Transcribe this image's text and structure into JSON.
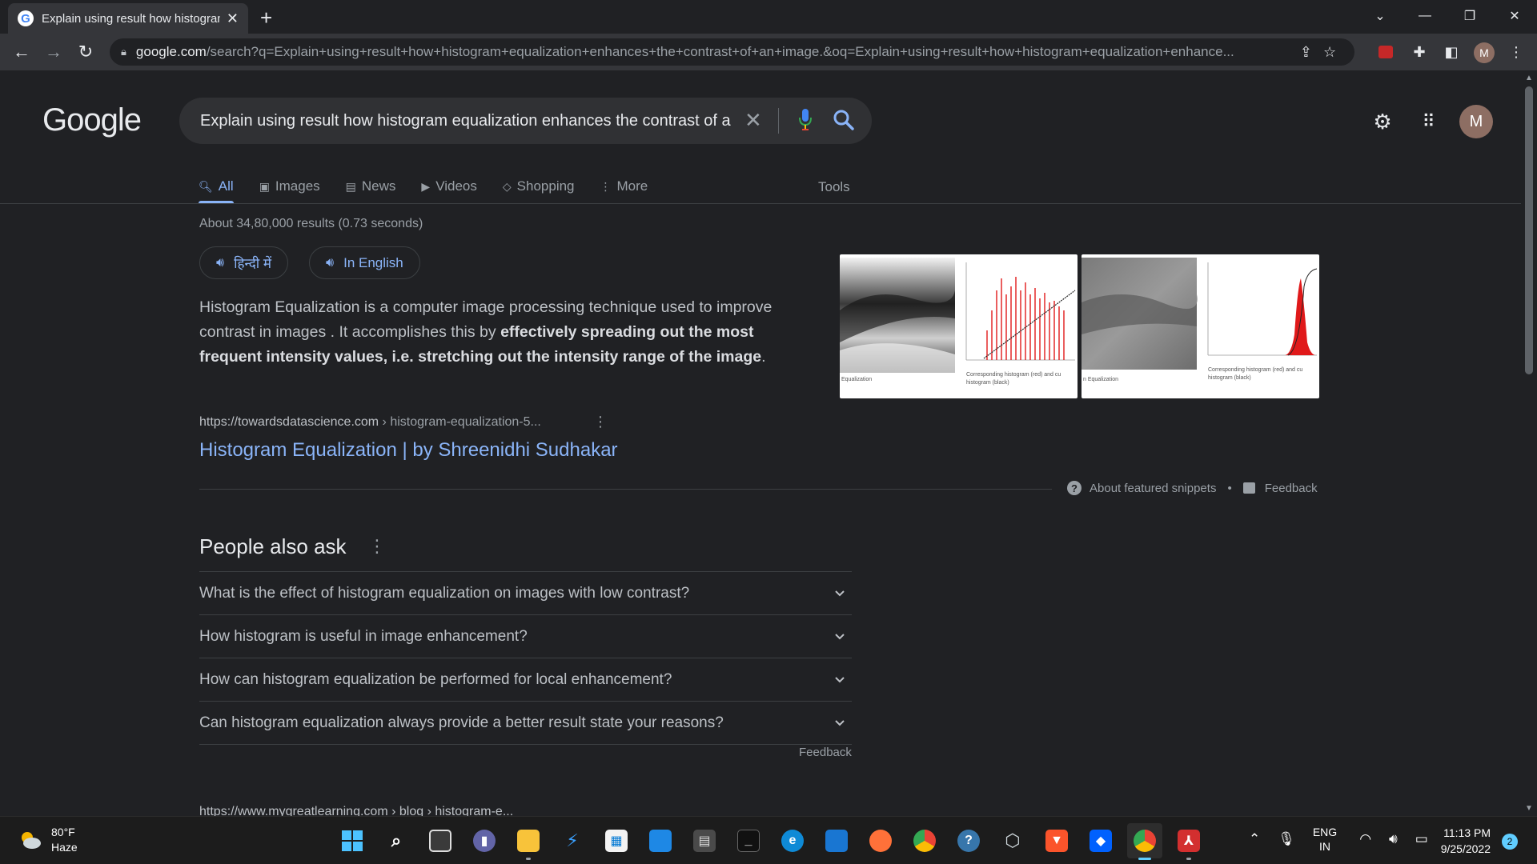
{
  "browser": {
    "tab_title": "Explain using result how histogram equalization",
    "url_host": "google.com",
    "url_path": "/search?q=Explain+using+result+how+histogram+equalization+enhances+the+contrast+of+an+image.&oq=Explain+using+result+how+histogram+equalization+enhance...",
    "profile_initial": "M"
  },
  "google": {
    "logo": "Google",
    "query": "Explain using result how histogram equalization enhances the contrast of a",
    "avatar_initial": "M",
    "tabs": [
      {
        "label": "All",
        "icon": "search-icon"
      },
      {
        "label": "Images",
        "icon": "image-icon"
      },
      {
        "label": "News",
        "icon": "news-icon"
      },
      {
        "label": "Videos",
        "icon": "video-icon"
      },
      {
        "label": "Shopping",
        "icon": "tag-icon"
      },
      {
        "label": "More",
        "icon": "more-vert-icon"
      }
    ],
    "tools_label": "Tools",
    "result_stats": "About 34,80,000 results (0.73 seconds)",
    "lang_buttons": [
      "हिन्दी में",
      "In English"
    ],
    "snippet": {
      "plain": "Histogram Equalization is a computer image processing technique used to improve contrast in images . It accomplishes this by ",
      "bold": "effectively spreading out the most frequent intensity values, i.e. stretching out the intensity range of the image",
      "end": "."
    },
    "thumbnails": [
      {
        "left_caption": "Equalization",
        "right_caption_1": "Corresponding histogram (red) and cu",
        "right_caption_2": "histogram (black)"
      },
      {
        "left_caption": "n Equalization",
        "right_caption_1": "Corresponding histogram (red) and cu",
        "right_caption_2": "histogram (black)"
      }
    ],
    "source": {
      "url": "https://towardsdatascience.com",
      "path": " › histogram-equalization-5...",
      "title": "Histogram Equalization | by Shreenidhi Sudhakar"
    },
    "about_snippets": "About featured snippets",
    "dot": "•",
    "feedback": "Feedback",
    "paa": {
      "title": "People also ask",
      "questions": [
        "What is the effect of histogram equalization on images with low contrast?",
        "How histogram is useful in image enhancement?",
        "How can histogram equalization be performed for local enhancement?",
        "Can histogram equalization always provide a better result state your reasons?"
      ],
      "feedback": "Feedback"
    },
    "next_result_cite": "https://www.mygreatlearning.com › blog › histogram-e..."
  },
  "taskbar": {
    "temperature": "80°F",
    "condition": "Haze",
    "lang_top": "ENG",
    "lang_bottom": "IN",
    "time": "11:13 PM",
    "date": "9/25/2022",
    "notification_count": "2"
  },
  "colors": {
    "background": "#202124",
    "link": "#8ab4f8",
    "histogram_red": "#e0191a"
  }
}
